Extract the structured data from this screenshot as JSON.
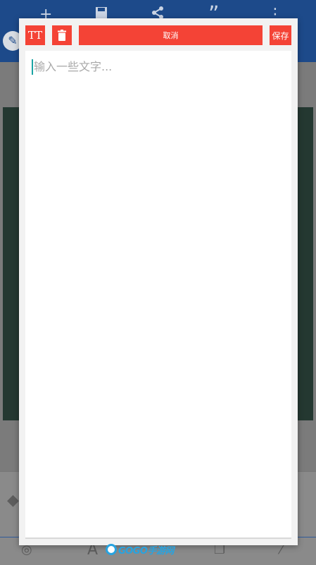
{
  "background": {
    "topbar_icons": [
      {
        "name": "add-icon",
        "glyph": "+"
      },
      {
        "name": "save-icon",
        "glyph": "▣"
      },
      {
        "name": "share-icon",
        "glyph": "<"
      },
      {
        "name": "quote-icon",
        "glyph": "”"
      },
      {
        "name": "more-icon",
        "glyph": "⋮"
      }
    ]
  },
  "dialog": {
    "text_style_label": "TT",
    "cancel_label": "取消",
    "save_label": "保存",
    "text_placeholder": "输入一些文字..."
  },
  "watermark": {
    "brand": "GOGO手游网"
  },
  "colors": {
    "accent": "#f44336",
    "app_bar": "#1d4a8a",
    "caret": "#1aa3a3"
  }
}
